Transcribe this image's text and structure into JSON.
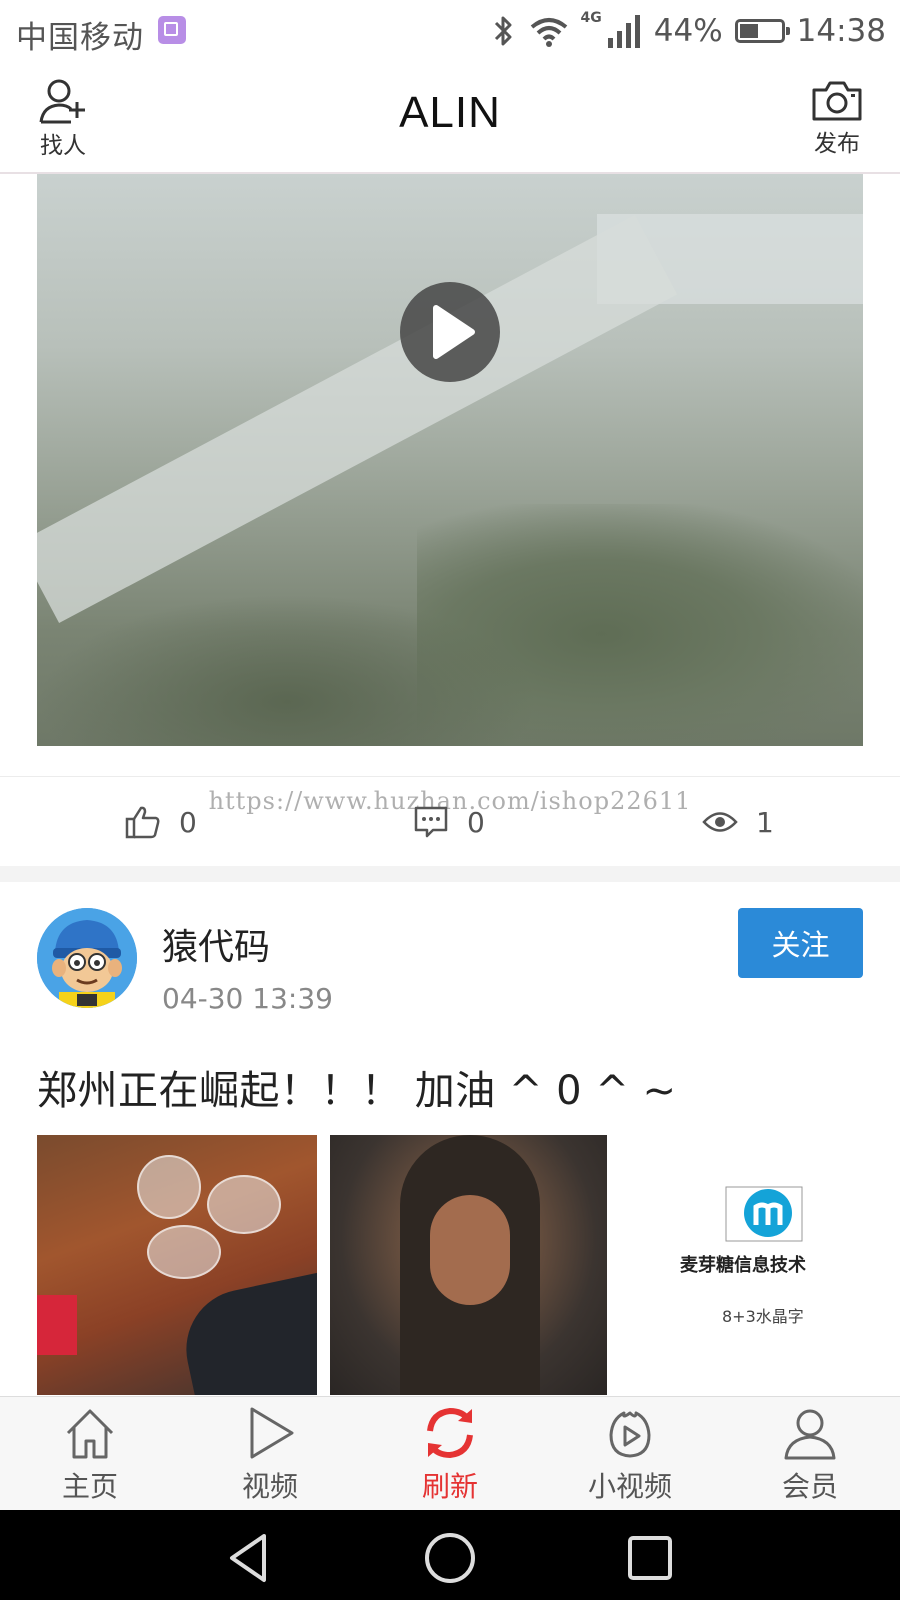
{
  "status_bar": {
    "carrier": "中国移动",
    "network": "4G",
    "battery": "44%",
    "battery_level": 0.44,
    "time": "14:38"
  },
  "header": {
    "title": "ALIN",
    "left_button": "找人",
    "right_button": "发布"
  },
  "video": {
    "play_icon": "play-icon"
  },
  "stats": {
    "likes": "0",
    "comments": "0",
    "views": "1",
    "watermark": "https://www.huzhan.com/ishop22611"
  },
  "post": {
    "username": "猿代码",
    "time": "04-30 13:39",
    "follow_label": "关注",
    "text": "郑州正在崛起！！！ 加油 ^ 0 ^ ~",
    "thumbnails": [
      {
        "icon": "tea-table-photo"
      },
      {
        "icon": "long-hair-man-photo"
      },
      {
        "icon": "company-logo-image",
        "company": "麦芽糖信息技术",
        "caption": "8+3水晶字"
      }
    ]
  },
  "bottom_nav": {
    "items": [
      {
        "label": "主页",
        "icon": "home-icon"
      },
      {
        "label": "视频",
        "icon": "play-outline-icon"
      },
      {
        "label": "刷新",
        "icon": "refresh-icon",
        "active": true
      },
      {
        "label": "小视频",
        "icon": "short-video-icon"
      },
      {
        "label": "会员",
        "icon": "person-icon"
      }
    ]
  },
  "colors": {
    "accent": "#e53333",
    "follow_button": "#2b8ad8"
  }
}
